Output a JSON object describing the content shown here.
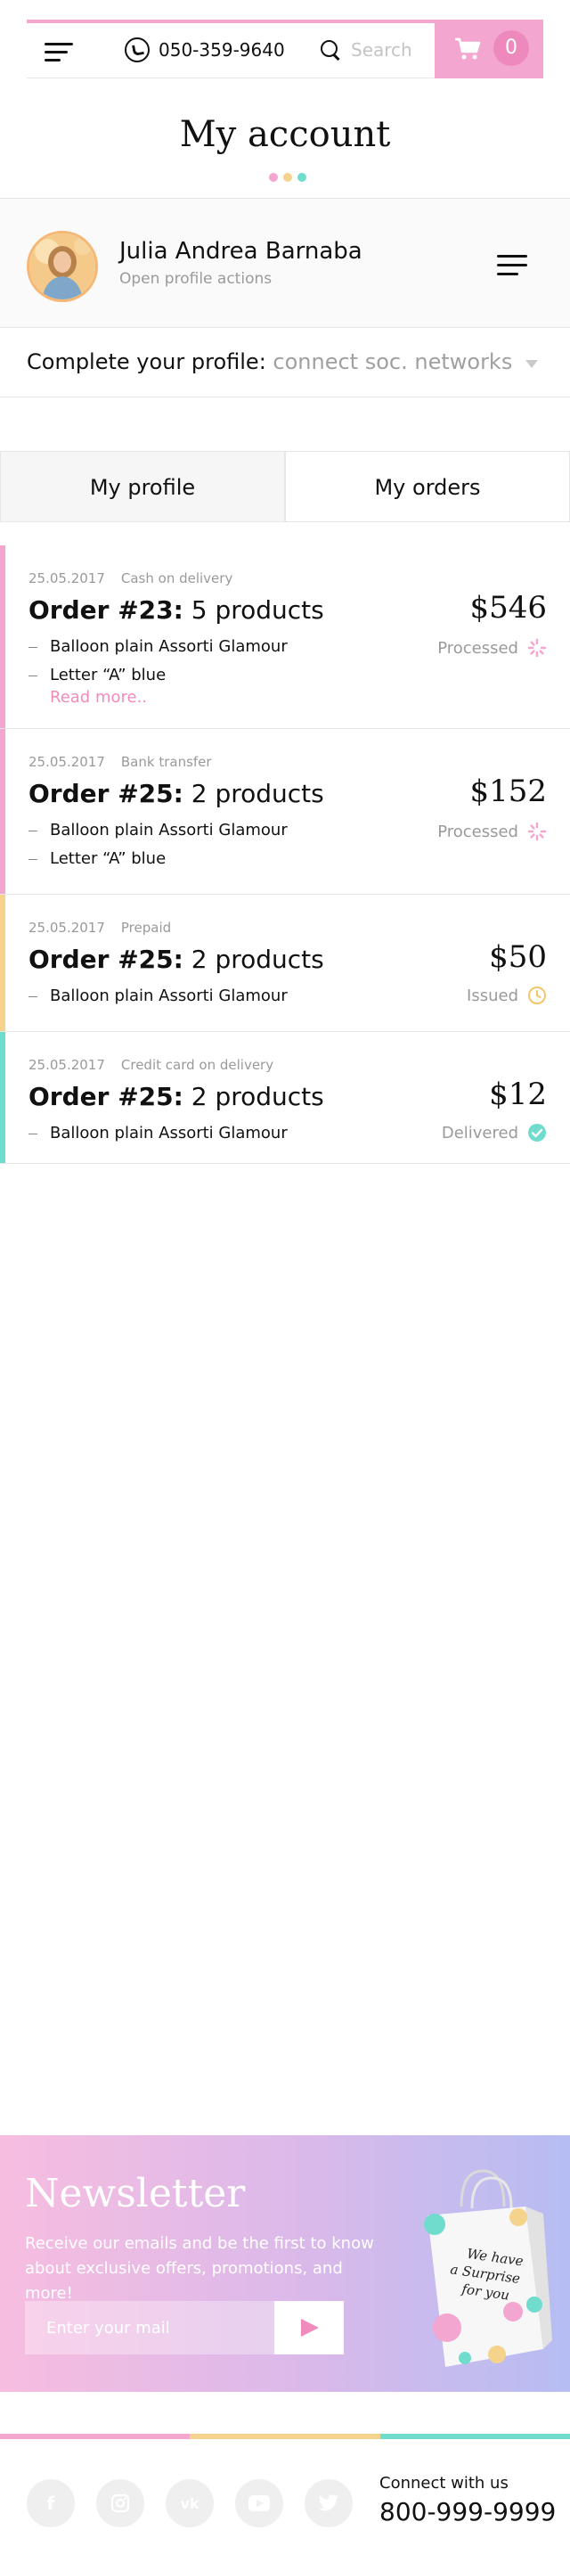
{
  "header": {
    "phone": "050-359-9640",
    "search_placeholder": "Search",
    "cart_count": "0"
  },
  "page_title": "My account",
  "profile": {
    "name": "Julia Andrea Barnaba",
    "subtitle": "Open profile actions"
  },
  "complete_profile": {
    "label": "Complete your profile:",
    "value": "connect soc. networks"
  },
  "tabs": [
    {
      "label": "My profile",
      "active": false
    },
    {
      "label": "My orders",
      "active": true
    }
  ],
  "orders": [
    {
      "date": "25.05.2017",
      "payment": "Cash on delivery",
      "title_bold": "Order #23:",
      "title_rest": "5 products",
      "items": [
        "Balloon plain Assorti Glamour",
        "Letter “A” blue"
      ],
      "read_more": "Read more..",
      "price": "$546",
      "status": "Processed",
      "status_icon": "spinner-icon",
      "accent": "#f3a6cf"
    },
    {
      "date": "25.05.2017",
      "payment": "Bank transfer",
      "title_bold": "Order #25:",
      "title_rest": "2 products",
      "items": [
        "Balloon plain Assorti Glamour",
        "Letter “A” blue"
      ],
      "price": "$152",
      "status": "Processed",
      "status_icon": "spinner-icon",
      "accent": "#f3a6cf"
    },
    {
      "date": "25.05.2017",
      "payment": "Prepaid",
      "title_bold": "Order #25:",
      "title_rest": "2 products",
      "items": [
        "Balloon plain Assorti Glamour"
      ],
      "price": "$50",
      "status": "Issued",
      "status_icon": "clock-icon",
      "accent": "#f5d38c"
    },
    {
      "date": "25.05.2017",
      "payment": "Credit card on delivery",
      "title_bold": "Order #25:",
      "title_rest": "2 products",
      "items": [
        "Balloon plain Assorti Glamour"
      ],
      "price": "$12",
      "status": "Delivered",
      "status_icon": "check-circle-icon",
      "accent": "#6fdccd"
    }
  ],
  "newsletter": {
    "title": "Newsletter",
    "text": "Receive our emails and be the first to know about exclusive offers, promotions, and more!",
    "input_placeholder": "Enter your mail",
    "bag_text": "We have a Surprise for you"
  },
  "footer": {
    "connect_label": "Connect with us",
    "phone": "800-999-9999",
    "socials": [
      "facebook-icon",
      "instagram-icon",
      "vk-icon",
      "youtube-icon",
      "twitter-icon"
    ]
  },
  "colors": {
    "pink": "#f3a6cf",
    "yellow": "#f5d38c",
    "teal": "#6fdccd"
  }
}
